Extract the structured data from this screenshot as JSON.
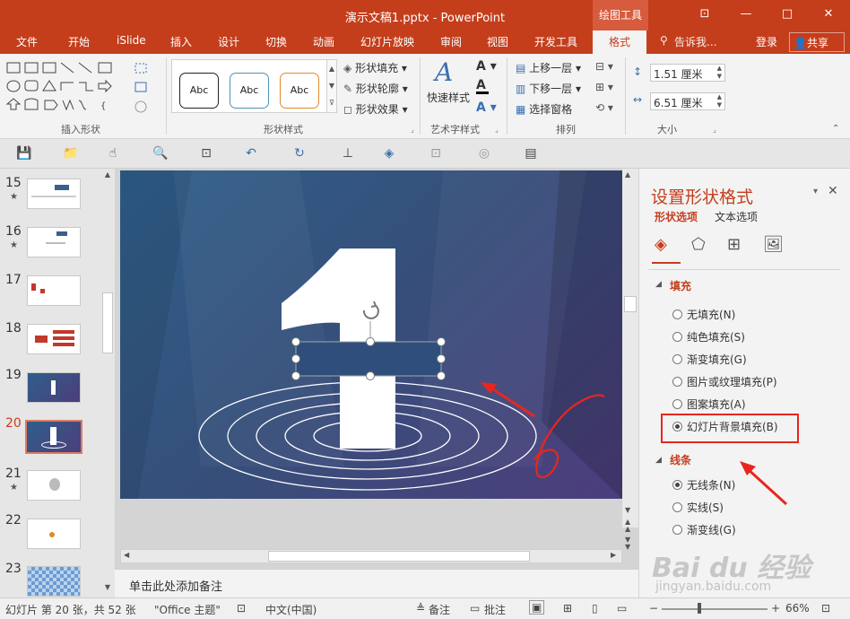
{
  "window": {
    "title": "演示文稿1.pptx - PowerPoint",
    "context_tab": "绘图工具",
    "minimize": "—",
    "maximize": "□",
    "close": "✕",
    "restore": "⊡"
  },
  "tabs": [
    "文件",
    "开始",
    "iSlide",
    "插入",
    "设计",
    "切换",
    "动画",
    "幻灯片放映",
    "审阅",
    "视图",
    "开发工具"
  ],
  "active_tab": "格式",
  "tellme": "告诉我...",
  "login": "登录",
  "share": "共享",
  "ribbon": {
    "insert_shapes_label": "插入形状",
    "shape_styles_label": "形状样式",
    "abc": [
      "Abc",
      "Abc",
      "Abc"
    ],
    "shape_fill": "形状填充",
    "shape_outline": "形状轮廓",
    "shape_effects": "形状效果",
    "quick_styles": "快速样式",
    "wordart_label": "艺术字样式",
    "bring_forward": "上移一层",
    "send_backward": "下移一层",
    "selection_pane": "选择窗格",
    "arrange_label": "排列",
    "height": "1.51 厘米",
    "width": "6.51 厘米",
    "size_label": "大小",
    "text_a": "A"
  },
  "thumbs": [
    {
      "num": "15",
      "star": "★"
    },
    {
      "num": "16",
      "star": "★"
    },
    {
      "num": "17",
      "star": ""
    },
    {
      "num": "18",
      "star": ""
    },
    {
      "num": "19",
      "star": ""
    },
    {
      "num": "20",
      "star": ""
    },
    {
      "num": "21",
      "star": "★"
    },
    {
      "num": "22",
      "star": ""
    },
    {
      "num": "23",
      "star": ""
    }
  ],
  "slide": {
    "big_number": "1"
  },
  "notes_placeholder": "单击此处添加备注",
  "pane": {
    "title": "设置形状格式",
    "tab_shape": "形状选项",
    "tab_text": "文本选项",
    "fill_section": "填充",
    "fill_options": [
      "无填充(N)",
      "纯色填充(S)",
      "渐变填充(G)",
      "图片或纹理填充(P)",
      "图案填充(A)",
      "幻灯片背景填充(B)"
    ],
    "fill_selected": 5,
    "line_section": "线条",
    "line_options": [
      "无线条(N)",
      "实线(S)",
      "渐变线(G)"
    ],
    "line_selected": 0
  },
  "status": {
    "slide_info": "幻灯片 第 20 张，共 52 张",
    "theme": "\"Office 主题\"",
    "language": "中文(中国)",
    "notes_btn": "备注",
    "comments_btn": "批注",
    "zoom": "66%",
    "minus": "−",
    "plus": "+"
  },
  "watermark": {
    "line1": "Bai du 经验",
    "line2": "jingyan.baidu.com"
  },
  "colors": {
    "accent": "#c43e1c",
    "slide_bg": "#35507a",
    "annotation": "#e8261f"
  }
}
